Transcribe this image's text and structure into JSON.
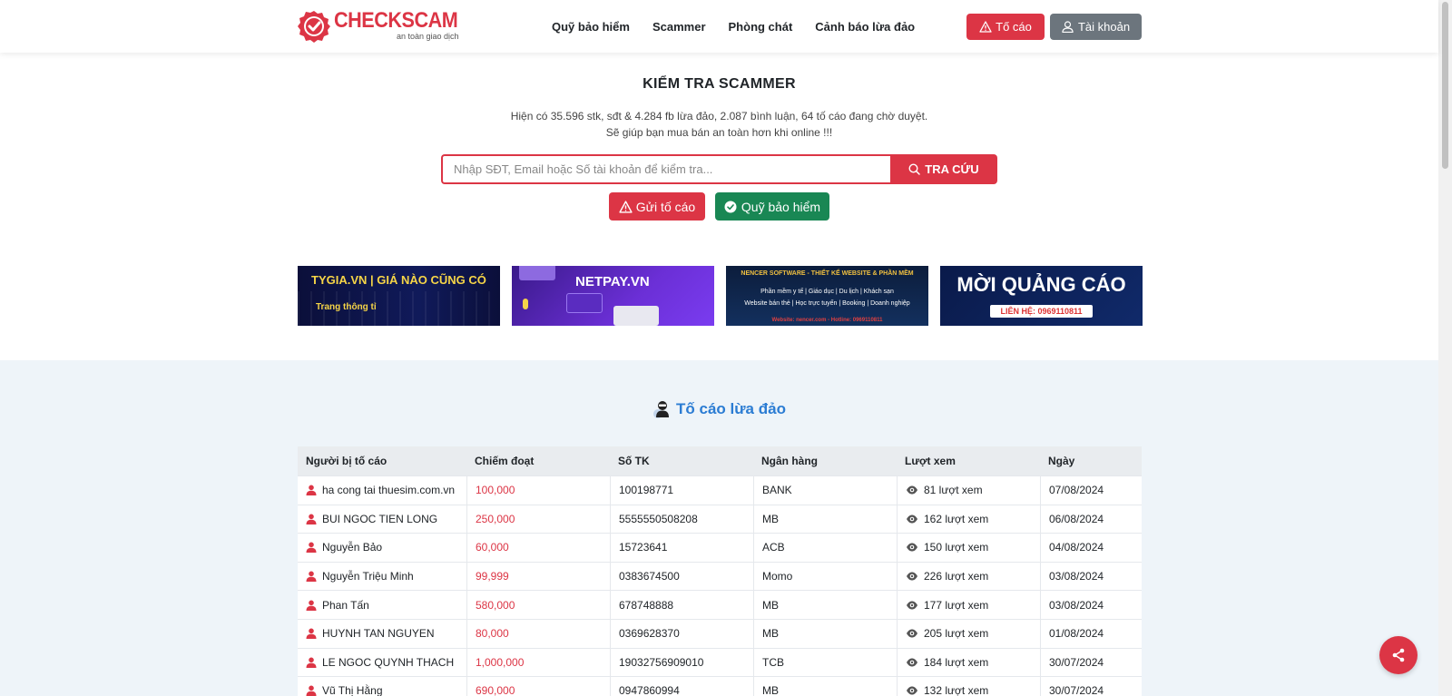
{
  "header": {
    "logo_name": "CHECKSCAM",
    "logo_tagline": "an toàn giao dịch",
    "nav": [
      "Quỹ bảo hiểm",
      "Scammer",
      "Phòng chát",
      "Cảnh báo lừa đảo"
    ],
    "report_button": "Tố cáo",
    "account_button": "Tài khoản"
  },
  "hero": {
    "title": "KIỂM TRA SCAMMER",
    "line1": "Hiện có 35.596 stk, sđt & 4.284 fb lừa đảo, 2.087 bình luận, 64 tố cáo đang chờ duyệt.",
    "line2": "Sẽ giúp bạn mua bán an toàn hơn khi online !!!",
    "search_placeholder": "Nhập SĐT, Email hoặc Số tài khoản để kiểm tra...",
    "search_button": "TRA CỨU",
    "send_report_button": "Gửi tố cáo",
    "fund_button": "Quỹ bảo hiểm"
  },
  "banners": {
    "b1_title": "TYGIA.VN | GIÁ NÀO CŨNG CÓ",
    "b1_sub": "Trang thông tỉ",
    "b2_title": "NETPAY.VN",
    "b3_title": "NENCER SOFTWARE - THIẾT KẾ WEBSITE & PHẦN MỀM",
    "b3_line1": "Phần mềm y tế | Giáo dục | Du lịch | Khách sạn",
    "b3_line2": "Website bán thẻ | Học trực tuyến | Booking | Doanh nghiệp",
    "b3_footer": "Website: nencer.com - Hotline: 0969110811",
    "b4_title": "MỜI QUẢNG CÁO",
    "b4_sub": "LIÊN HỆ: 0969110811"
  },
  "reports": {
    "title": "Tố cáo lừa đảo",
    "columns": [
      "Người bị tố cáo",
      "Chiếm đoạt",
      "Số TK",
      "Ngân hàng",
      "Lượt xem",
      "Ngày"
    ],
    "rows": [
      {
        "name": "ha cong tai thuesim.com.vn",
        "amount": "100,000",
        "account": "100198771",
        "bank": "BANK",
        "views": "81 lượt xem",
        "date": "07/08/2024"
      },
      {
        "name": "BUI NGOC TIEN LONG",
        "amount": "250,000",
        "account": "5555550508208",
        "bank": "MB",
        "views": "162 lượt xem",
        "date": "06/08/2024"
      },
      {
        "name": "Nguyễn Bảo",
        "amount": "60,000",
        "account": "15723641",
        "bank": "ACB",
        "views": "150 lượt xem",
        "date": "04/08/2024"
      },
      {
        "name": "Nguyễn Triệu Minh",
        "amount": "99,999",
        "account": "0383674500",
        "bank": "Momo",
        "views": "226 lượt xem",
        "date": "03/08/2024"
      },
      {
        "name": "Phan Tấn",
        "amount": "580,000",
        "account": "678748888",
        "bank": "MB",
        "views": "177 lượt xem",
        "date": "03/08/2024"
      },
      {
        "name": "HUYNH TAN NGUYEN",
        "amount": "80,000",
        "account": "0369628370",
        "bank": "MB",
        "views": "205 lượt xem",
        "date": "01/08/2024"
      },
      {
        "name": "LE NGOC QUYNH THACH",
        "amount": "1,000,000",
        "account": "19032756909010",
        "bank": "TCB",
        "views": "184 lượt xem",
        "date": "30/07/2024"
      },
      {
        "name": "Vũ Thị Hằng",
        "amount": "690,000",
        "account": "0947860994",
        "bank": "MB",
        "views": "132 lượt xem",
        "date": "30/07/2024"
      }
    ]
  },
  "colors": {
    "primary": "#dc3545",
    "success": "#198754",
    "secondary": "#6c757d",
    "link": "#2b7cd3"
  }
}
